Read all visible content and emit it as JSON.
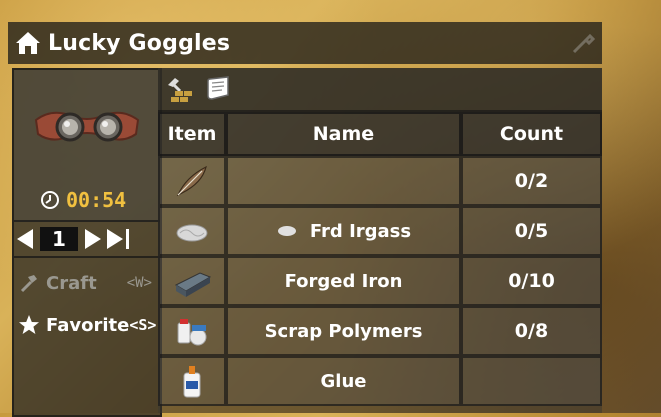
{
  "window": {
    "title": "Lucky Goggles",
    "icons": {
      "home": "home-icon",
      "corner": "wrench-icon"
    }
  },
  "preview": {
    "item_icon": "goggles-icon",
    "timer": "00:54"
  },
  "quantity": {
    "value": "1"
  },
  "actions": {
    "craft_label": "Craft",
    "craft_key": "<W>",
    "favorite_label": "Favorite",
    "favorite_key": "<S>"
  },
  "tabs": [
    {
      "icon": "hammer-bricks-icon"
    },
    {
      "icon": "book-icon"
    }
  ],
  "table": {
    "headers": {
      "item": "Item",
      "name": "Name",
      "count": "Count"
    },
    "rows": [
      {
        "icon": "feather-icon",
        "name": "",
        "count": "0/2"
      },
      {
        "icon": "fiberglass-icon",
        "name": "Frd Irgass",
        "count": "0/5"
      },
      {
        "icon": "forged-iron-icon",
        "name": "Forged Iron",
        "count": "0/10"
      },
      {
        "icon": "scrap-polymers-icon",
        "name": "Scrap Polymers",
        "count": "0/8"
      },
      {
        "icon": "glue-icon",
        "name": "Glue",
        "count": ""
      }
    ]
  },
  "colors": {
    "timer": "#f0c040",
    "panel": "#2d2a24",
    "text": "#ffffff",
    "disabled": "#9a9890"
  }
}
